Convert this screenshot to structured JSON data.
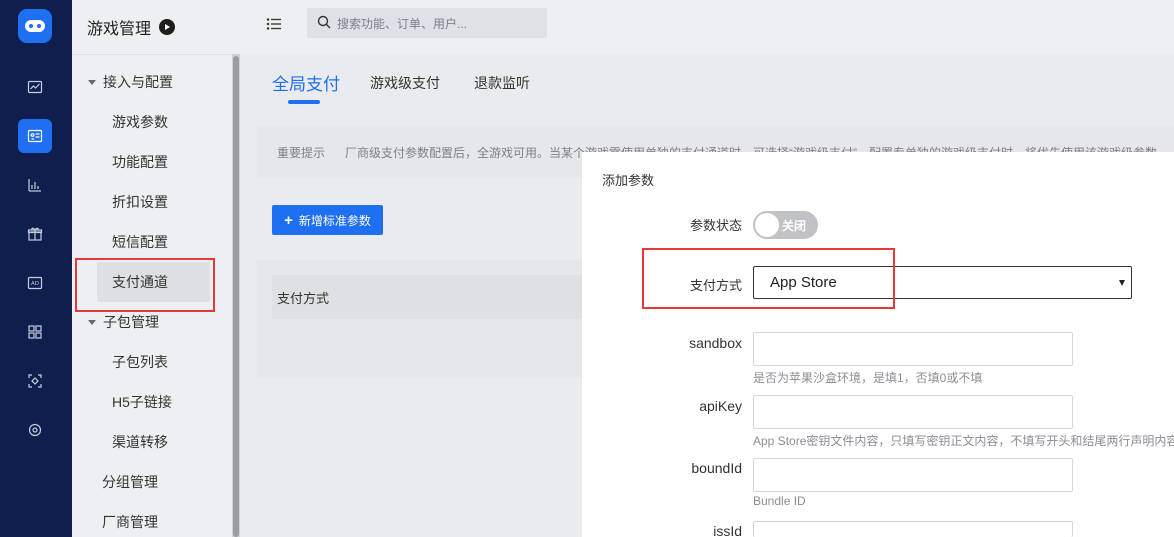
{
  "rail": {
    "icons": [
      "gamepad-logo-icon",
      "line-chart-icon",
      "id-card-icon",
      "bar-chart-icon",
      "gift-icon",
      "ad-icon",
      "grid-icon",
      "tag-scan-icon",
      "settings-icon"
    ],
    "accent": "#1f6ff2",
    "background": "#0f1e4d"
  },
  "sidebar": {
    "title": "游戏管理",
    "groups": [
      {
        "label": "接入与配置",
        "items": [
          "游戏参数",
          "功能配置",
          "折扣设置",
          "短信配置",
          "支付通道"
        ]
      },
      {
        "label": "子包管理",
        "items": [
          "子包列表",
          "H5子链接",
          "渠道转移"
        ]
      }
    ],
    "plain_items": [
      "分组管理",
      "厂商管理"
    ],
    "active_item": "支付通道"
  },
  "topbar": {
    "search_placeholder": "搜索功能、订单、用户..."
  },
  "tabs": [
    {
      "label": "全局支付",
      "active": true
    },
    {
      "label": "游戏级支付",
      "active": false
    },
    {
      "label": "退款监听",
      "active": false
    }
  ],
  "notice": {
    "label": "重要提示",
    "text": "厂商级支付参数配置后，全游戏可用。当某个游戏需使用单独的支付通道时，可选择“游戏级支付”，配置专单独的游戏级支付时，将优先使用该游戏级参数"
  },
  "add_button": {
    "label": "新增标准参数"
  },
  "table": {
    "header": "支付方式"
  },
  "modal": {
    "title": "添加参数",
    "status_label": "参数状态",
    "status_toggle": "关闭",
    "pay_method_label": "支付方式",
    "pay_method_value": "App Store",
    "fields": [
      {
        "label": "sandbox",
        "value": "",
        "hint": "是否为苹果沙盒环境，是填1，否填0或不填"
      },
      {
        "label": "apiKey",
        "value": "",
        "hint": "App Store密钥文件内容，只填写密钥正文内容，不填写开头和结尾两行声明内容"
      },
      {
        "label": "boundId",
        "value": "",
        "hint": "Bundle ID"
      },
      {
        "label": "issId",
        "value": "",
        "hint": ""
      }
    ]
  },
  "colors": {
    "highlight": "#e53a3a",
    "primary": "#1f6ff2"
  }
}
